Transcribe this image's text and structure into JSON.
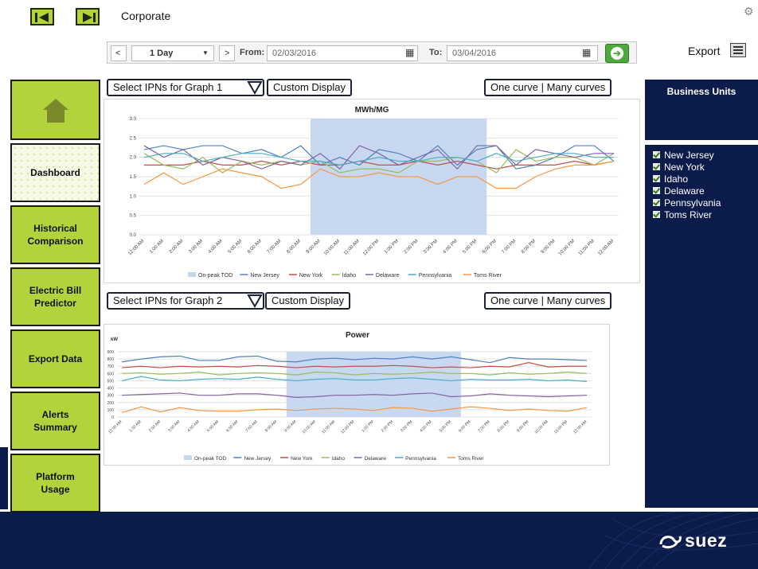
{
  "header": {
    "title": "Corporate"
  },
  "toolbar": {
    "prev": "<",
    "period": "1 Day",
    "next": ">",
    "from_label": "From:",
    "from_value": "02/03/2016",
    "to_label": "To:",
    "to_value": "03/04/2016",
    "export_label": "Export"
  },
  "sidebar": {
    "items": [
      {
        "label": "Dashboard"
      },
      {
        "label": "Historical Comparison"
      },
      {
        "label": "Electric Bill Predictor"
      },
      {
        "label": "Export Data"
      },
      {
        "label": "Alerts Summary"
      },
      {
        "label": "Platform Usage"
      }
    ]
  },
  "graph1": {
    "select_label": "Select IPNs for Graph 1",
    "custom_label": "Custom Display",
    "curves_label": "One curve | Many curves"
  },
  "graph2": {
    "select_label": "Select IPNs for Graph 2",
    "custom_label": "Custom Display",
    "curves_label": "One curve | Many curves"
  },
  "business_units": {
    "title": "Business Units",
    "items": [
      "New Jersey",
      "New York",
      "Idaho",
      "Delaware",
      "Pennsylvania",
      "Toms River"
    ]
  },
  "brand": {
    "name": "suez"
  },
  "colors": {
    "accent_green": "#b2d33b",
    "navy": "#0b1b4a",
    "onpeak": "#c5d6ef",
    "new_jersey": "#4f81bd",
    "new_york": "#c0504d",
    "idaho": "#9bbb59",
    "delaware": "#8064a2",
    "pennsylvania": "#4bacc6",
    "toms_river": "#f79646"
  },
  "chart_data": [
    {
      "type": "line",
      "title": "MWh/MG",
      "ylabel": "",
      "ylim": [
        0,
        3.0
      ],
      "yticks": [
        "0.0",
        "0.5",
        "1.0",
        "1.5",
        "2.0",
        "2.5",
        "3.0"
      ],
      "categories": [
        "12:00 AM",
        "1:00 AM",
        "2:00 AM",
        "3:00 AM",
        "4:00 AM",
        "5:00 AM",
        "6:00 AM",
        "7:00 AM",
        "8:00 AM",
        "9:00 AM",
        "10:00 AM",
        "11:00 AM",
        "12:00 PM",
        "1:00 PM",
        "2:00 PM",
        "3:00 PM",
        "4:00 PM",
        "5:00 PM",
        "6:00 PM",
        "7:00 PM",
        "8:00 PM",
        "9:00 PM",
        "10:00 PM",
        "11:00 PM",
        "12:00 AM"
      ],
      "onpeak_range": [
        9,
        18
      ],
      "legend": [
        "On-peak TOD",
        "New Jersey",
        "New York",
        "Idaho",
        "Delaware",
        "Pennsylvania",
        "Toms River"
      ],
      "series": [
        {
          "name": "New Jersey",
          "values": [
            2.2,
            2.3,
            2.2,
            2.3,
            2.3,
            2.1,
            2.2,
            2.0,
            2.3,
            1.8,
            2.0,
            1.8,
            2.2,
            2.1,
            1.9,
            2.3,
            1.8,
            2.2,
            2.3,
            1.7,
            1.8,
            2.0,
            2.3,
            2.3,
            1.9
          ]
        },
        {
          "name": "New York",
          "values": [
            1.8,
            1.8,
            1.8,
            1.9,
            1.8,
            1.8,
            1.9,
            1.8,
            1.9,
            1.8,
            1.8,
            1.9,
            1.8,
            1.8,
            1.9,
            1.8,
            1.9,
            1.8,
            1.7,
            1.8,
            1.8,
            1.8,
            1.9,
            1.8,
            1.9
          ]
        },
        {
          "name": "Idaho",
          "values": [
            2.1,
            1.8,
            1.7,
            2.0,
            1.6,
            1.9,
            1.8,
            1.9,
            1.8,
            1.9,
            1.6,
            1.7,
            1.7,
            1.6,
            1.9,
            1.9,
            2.0,
            1.9,
            1.6,
            2.2,
            1.9,
            2.0,
            2.0,
            1.8,
            2.1
          ]
        },
        {
          "name": "Delaware",
          "values": [
            2.3,
            2.0,
            2.2,
            1.8,
            2.0,
            1.9,
            1.7,
            1.9,
            1.8,
            2.1,
            1.7,
            2.3,
            2.1,
            1.8,
            2.0,
            2.2,
            1.7,
            2.3,
            2.3,
            1.8,
            2.2,
            2.1,
            2.0,
            2.1,
            2.1
          ]
        },
        {
          "name": "Pennsylvania",
          "values": [
            2.0,
            2.1,
            2.1,
            1.9,
            2.0,
            2.1,
            2.1,
            2.0,
            1.9,
            1.9,
            1.8,
            1.9,
            2.0,
            1.9,
            1.9,
            2.0,
            2.0,
            1.9,
            2.1,
            1.9,
            2.0,
            2.1,
            2.1,
            2.0,
            2.0
          ]
        },
        {
          "name": "Toms River",
          "values": [
            1.3,
            1.6,
            1.3,
            1.5,
            1.7,
            1.6,
            1.5,
            1.2,
            1.3,
            1.7,
            1.5,
            1.5,
            1.6,
            1.5,
            1.5,
            1.3,
            1.5,
            1.5,
            1.2,
            1.2,
            1.5,
            1.7,
            1.8,
            1.8,
            1.9
          ]
        }
      ]
    },
    {
      "type": "line",
      "title": "Power",
      "ylabel": "kW",
      "ylim": [
        0,
        900
      ],
      "yticks": [
        "0",
        "100",
        "200",
        "300",
        "400",
        "500",
        "600",
        "700",
        "800",
        "900"
      ],
      "categories": [
        "12:00 AM",
        "1:00 AM",
        "2:00 AM",
        "3:00 AM",
        "4:00 AM",
        "5:00 AM",
        "6:00 AM",
        "7:00 AM",
        "8:00 AM",
        "9:00 AM",
        "10:00 AM",
        "11:00 AM",
        "12:00 PM",
        "1:00 PM",
        "2:00 PM",
        "3:00 PM",
        "4:00 PM",
        "5:00 PM",
        "6:00 PM",
        "7:00 PM",
        "8:00 PM",
        "9:00 PM",
        "10:00 PM",
        "11:00 PM",
        "12:00 AM"
      ],
      "onpeak_range": [
        9,
        18
      ],
      "legend": [
        "On-peak TOD",
        "New Jersey",
        "New York",
        "Idaho",
        "Delaware",
        "Pennsylvania",
        "Toms River"
      ],
      "series": [
        {
          "name": "New Jersey",
          "values": [
            760,
            800,
            830,
            840,
            780,
            780,
            830,
            840,
            770,
            760,
            800,
            810,
            790,
            810,
            800,
            830,
            800,
            830,
            790,
            750,
            820,
            800,
            800,
            790,
            780
          ]
        },
        {
          "name": "New York",
          "values": [
            680,
            700,
            680,
            700,
            690,
            700,
            690,
            710,
            700,
            680,
            700,
            690,
            700,
            700,
            710,
            700,
            680,
            690,
            680,
            700,
            690,
            750,
            690,
            700,
            700
          ]
        },
        {
          "name": "Idaho",
          "values": [
            600,
            610,
            590,
            600,
            620,
            580,
            600,
            610,
            600,
            580,
            620,
            610,
            580,
            600,
            590,
            600,
            620,
            600,
            600,
            580,
            610,
            590,
            600,
            620,
            600
          ]
        },
        {
          "name": "Delaware",
          "values": [
            300,
            310,
            320,
            330,
            300,
            300,
            320,
            320,
            300,
            270,
            280,
            300,
            300,
            310,
            300,
            320,
            330,
            280,
            290,
            320,
            300,
            290,
            280,
            290,
            300
          ]
        },
        {
          "name": "Pennsylvania",
          "values": [
            500,
            560,
            510,
            500,
            520,
            530,
            520,
            550,
            520,
            500,
            520,
            530,
            510,
            510,
            530,
            540,
            520,
            500,
            520,
            510,
            510,
            520,
            500,
            510,
            490
          ]
        },
        {
          "name": "Toms River",
          "values": [
            60,
            140,
            70,
            130,
            90,
            80,
            80,
            100,
            110,
            90,
            110,
            120,
            110,
            90,
            130,
            120,
            80,
            110,
            140,
            120,
            90,
            110,
            90,
            80,
            130
          ]
        }
      ]
    }
  ]
}
